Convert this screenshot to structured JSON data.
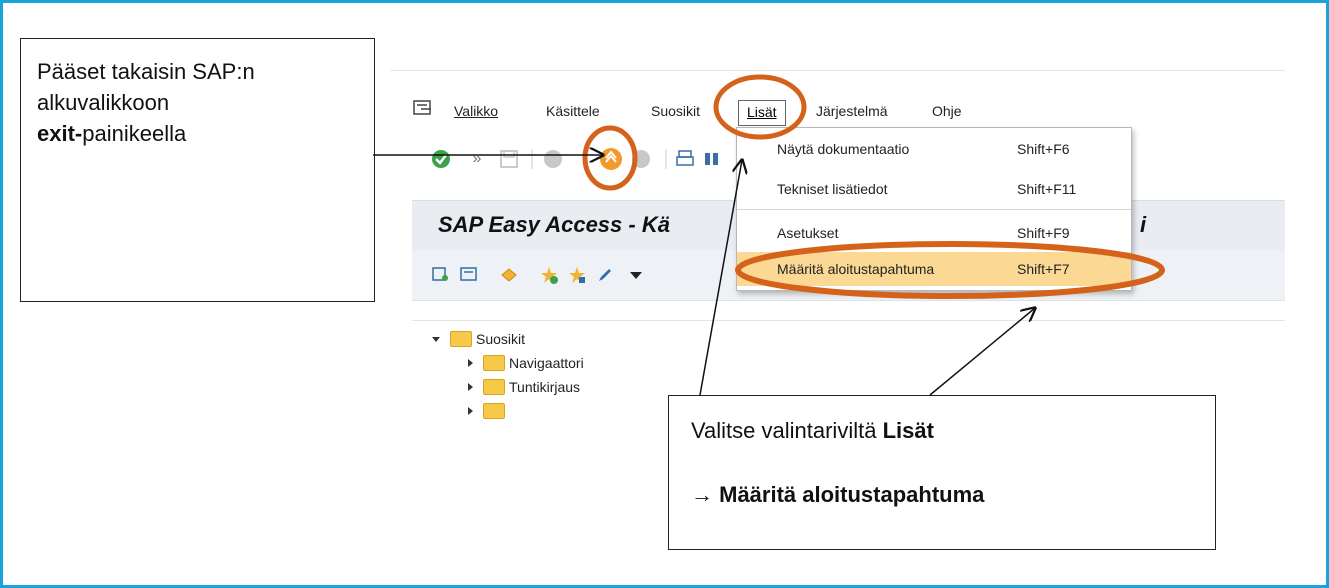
{
  "menubar": {
    "items": [
      {
        "label": "Valikko"
      },
      {
        "label": "Käsittele"
      },
      {
        "label": "Suosikit"
      },
      {
        "label": "Lisät"
      },
      {
        "label": "Järjestelmä"
      },
      {
        "label": "Ohje"
      }
    ]
  },
  "window": {
    "title": "SAP Easy Access  -  Kä"
  },
  "title_suffix": "i",
  "dropdown": {
    "items": [
      {
        "label": "Näytä dokumentaatio",
        "shortcut": "Shift+F6"
      },
      {
        "label": "Tekniset lisätiedot",
        "shortcut": "Shift+F11"
      },
      {
        "label": "Asetukset",
        "shortcut": "Shift+F9"
      },
      {
        "label": "Määritä aloitustapahtuma",
        "shortcut": "Shift+F7"
      }
    ]
  },
  "tree": {
    "root": "Suosikit",
    "children": [
      {
        "label": "Navigaattori"
      },
      {
        "label": "Tuntikirjaus"
      }
    ]
  },
  "callout_exit": {
    "line1": "Pääset takaisin SAP:n",
    "line2": "alkuvalikkoon",
    "bold": "exit-",
    "rest": "painikeella"
  },
  "callout_lisat": {
    "line1_prefix": "Valitse valintariviltä ",
    "line1_bold": "Lisät",
    "arrow": "→",
    "line2_bold": "Määritä aloitustapahtuma"
  },
  "colors": {
    "frame": "#1aa3d9",
    "highlight_ellipse": "#d4621b",
    "menu_highlight": "#fbd995"
  }
}
